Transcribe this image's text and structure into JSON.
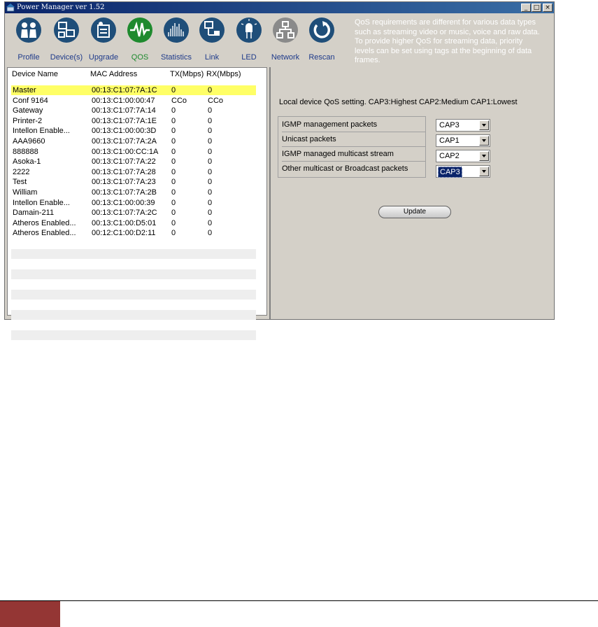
{
  "window": {
    "title": "Power Manager ver 1.52",
    "controls": [
      "_",
      "□",
      "×"
    ]
  },
  "toolbar": {
    "buttons": [
      {
        "label": "Profile",
        "icon": "profile-icon",
        "color": "#1f4e79"
      },
      {
        "label": "Device(s)",
        "icon": "devices-icon",
        "color": "#1f4e79"
      },
      {
        "label": "Upgrade",
        "icon": "upgrade-icon",
        "color": "#1f4e79"
      },
      {
        "label": "QOS",
        "icon": "qos-icon",
        "color": "#1e8a2e"
      },
      {
        "label": "Statistics",
        "icon": "statistics-icon",
        "color": "#1f4e79"
      },
      {
        "label": "Link",
        "icon": "link-icon",
        "color": "#1f4e79"
      },
      {
        "label": "LED",
        "icon": "led-icon",
        "color": "#1f4e79"
      },
      {
        "label": "Network",
        "icon": "network-icon",
        "color": "#8a8a8a"
      },
      {
        "label": "Rescan",
        "icon": "rescan-icon",
        "color": "#1f4e79"
      }
    ],
    "info": "QoS requirements are different for various data types such as streaming video or music, voice and raw data. To provide higher QoS for streaming data, priority levels can be set using tags at the beginning of data frames."
  },
  "devices": {
    "columns": [
      "Device Name",
      "MAC Address",
      "TX(Mbps)",
      "RX(Mbps)"
    ],
    "rows": [
      {
        "name": "Master",
        "mac": "00:13:C1:07:7A:1C",
        "tx": "0",
        "rx": "0",
        "selected": true
      },
      {
        "name": "Conf 9164",
        "mac": "00:13:C1:00:00:47",
        "tx": "CCo",
        "rx": "CCo"
      },
      {
        "name": "Gateway",
        "mac": "00:13:C1:07:7A:14",
        "tx": "0",
        "rx": "0"
      },
      {
        "name": "Printer-2",
        "mac": "00:13:C1:07:7A:1E",
        "tx": "0",
        "rx": "0"
      },
      {
        "name": "Intellon Enable...",
        "mac": "00:13:C1:00:00:3D",
        "tx": "0",
        "rx": "0"
      },
      {
        "name": "AAA9660",
        "mac": "00:13:C1:07:7A:2A",
        "tx": "0",
        "rx": "0"
      },
      {
        "name": "888888",
        "mac": "00:13:C1:00:CC:1A",
        "tx": "0",
        "rx": "0"
      },
      {
        "name": "Asoka-1",
        "mac": "00:13:C1:07:7A:22",
        "tx": "0",
        "rx": "0"
      },
      {
        "name": "2222",
        "mac": "00:13:C1:07:7A:28",
        "tx": "0",
        "rx": "0"
      },
      {
        "name": "Test",
        "mac": "00:13:C1:07:7A:23",
        "tx": "0",
        "rx": "0"
      },
      {
        "name": "William",
        "mac": "00:13:C1:07:7A:2B",
        "tx": "0",
        "rx": "0"
      },
      {
        "name": "Intellon Enable...",
        "mac": "00:13:C1:00:00:39",
        "tx": "0",
        "rx": "0"
      },
      {
        "name": "Damain-211",
        "mac": "00:13:C1:07:7A:2C",
        "tx": "0",
        "rx": "0"
      },
      {
        "name": "Atheros Enabled...",
        "mac": "00:13:C1:00:D5:01",
        "tx": "0",
        "rx": "0"
      },
      {
        "name": "Atheros Enabled...",
        "mac": "00:12:C1:00:D2:11",
        "tx": "0",
        "rx": "0"
      }
    ]
  },
  "qos": {
    "note": "Local device QoS setting. CAP3:Highest CAP2:Medium CAP1:Lowest",
    "settings": [
      {
        "label": "IGMP management packets",
        "value": "CAP3"
      },
      {
        "label": "Unicast packets",
        "value": "CAP1"
      },
      {
        "label": "IGMP managed multicast stream",
        "value": "CAP2"
      },
      {
        "label": "Other multicast or Broadcast packets",
        "value": "CAP3",
        "focused": true
      }
    ],
    "update_label": "Update"
  },
  "colors": {
    "selected_row": "#ffff66",
    "footer_accent": "#943634"
  }
}
